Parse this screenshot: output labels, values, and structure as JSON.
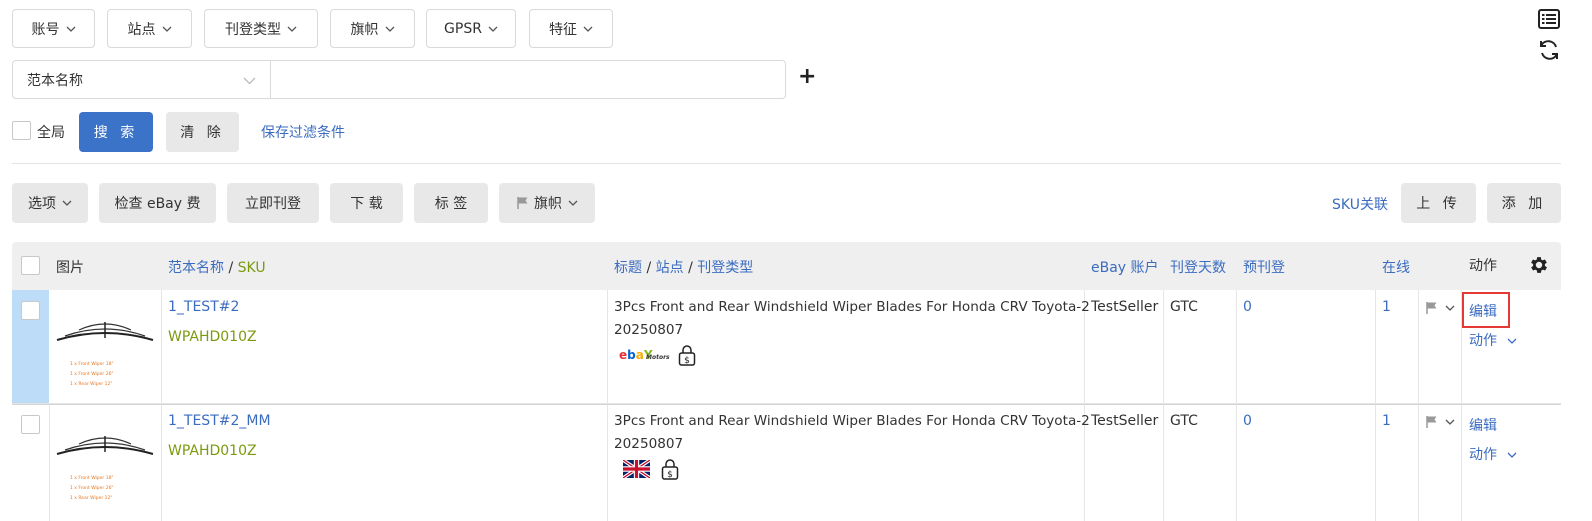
{
  "filters": {
    "account": "账号",
    "site": "站点",
    "listing_type": "刊登类型",
    "flag": "旗帜",
    "gpsr": "GPSR",
    "feature": "特征"
  },
  "search": {
    "field_select": "范本名称",
    "input_value": "",
    "add_symbol": "+"
  },
  "global_label": "全局",
  "search_button": "搜 索",
  "clear_button": "清 除",
  "save_filter_link": "保存过滤条件",
  "toolbar": {
    "options": "选项",
    "check_fee": "检查 eBay 费",
    "list_now": "立即刊登",
    "download": "下 载",
    "tag": "标 签",
    "flag": "旗帜",
    "sku_link": "SKU关联",
    "upload": "上 传",
    "add": "添 加"
  },
  "table": {
    "headers": {
      "image": "图片",
      "template_name": "范本名称",
      "slash1": "/",
      "sku": "SKU",
      "title": "标题",
      "slash2": "/",
      "site": "站点",
      "slash3": "/",
      "listing_type": "刊登类型",
      "ebay_account": "eBay 账户",
      "listing_days": "刊登天数",
      "pre_listing": "预刊登",
      "online": "在线",
      "action": "动作"
    },
    "rows": [
      {
        "name": "1_TEST#2",
        "sku": "WPAHD010Z",
        "title_line1": "3Pcs Front and Rear Windshield Wiper Blades For Honda CRV Toyota-2",
        "title_line2": "20250807",
        "site_icon": "ebay-motors-icon",
        "account": "TestSeller",
        "duration": "GTC",
        "pre_listing": "0",
        "online": "1",
        "edit": "编辑",
        "action": "动作",
        "selected": true
      },
      {
        "name": "1_TEST#2_MM",
        "sku": "WPAHD010Z",
        "title_line1": "3Pcs Front and Rear Windshield Wiper Blades For Honda CRV Toyota-2",
        "title_line2": "20250807",
        "site_icon": "uk-flag-icon",
        "account": "TestSeller",
        "duration": "GTC",
        "pre_listing": "0",
        "online": "1",
        "edit": "编辑",
        "action": "动作",
        "selected": false
      }
    ],
    "thumb_caption": [
      "1 x Front Wiper 18\"",
      "1 x Front Wiper 26\"",
      "1 x Rear Wiper 12\""
    ]
  },
  "colors": {
    "primary": "#3b73c9",
    "link": "#3b6cc0",
    "sku": "#7b9a10",
    "selected_row": "#bcdcf7",
    "highlight_box": "#e53935"
  }
}
